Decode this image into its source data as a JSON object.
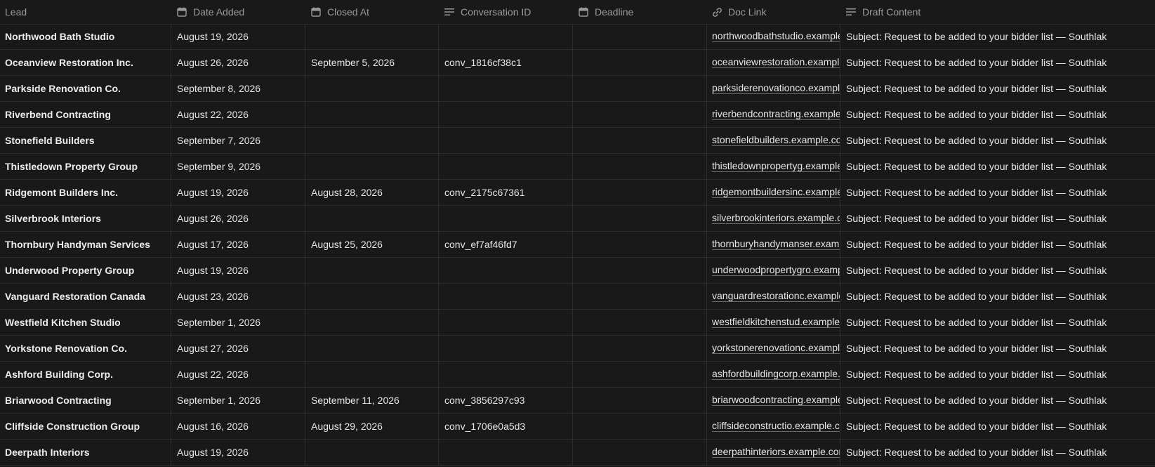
{
  "columns": [
    {
      "key": "lead",
      "label": "Lead",
      "icon": "none"
    },
    {
      "key": "date_added",
      "label": "Date Added",
      "icon": "calendar-icon"
    },
    {
      "key": "closed_at",
      "label": "Closed At",
      "icon": "calendar-icon"
    },
    {
      "key": "conversation_id",
      "label": "Conversation ID",
      "icon": "text-lines-icon"
    },
    {
      "key": "deadline",
      "label": "Deadline",
      "icon": "calendar-icon"
    },
    {
      "key": "doc_link",
      "label": "Doc Link",
      "icon": "link-icon"
    },
    {
      "key": "draft_content",
      "label": "Draft Content",
      "icon": "text-lines-icon"
    }
  ],
  "rows": [
    {
      "lead": "Northwood Bath Studio",
      "date_added": "August 19, 2026",
      "closed_at": "",
      "conversation_id": "",
      "deadline": "",
      "doc_link": "northwoodbathstudio.example",
      "draft_content": "Subject: Request to be added to your bidder list — Southlak"
    },
    {
      "lead": "Oceanview Restoration Inc.",
      "date_added": "August 26, 2026",
      "closed_at": "September 5, 2026",
      "conversation_id": "conv_1816cf38c1",
      "deadline": "",
      "doc_link": "oceanviewrestoration.example",
      "draft_content": "Subject: Request to be added to your bidder list — Southlak"
    },
    {
      "lead": "Parkside Renovation Co.",
      "date_added": "September 8, 2026",
      "closed_at": "",
      "conversation_id": "",
      "deadline": "",
      "doc_link": "parksiderenovationco.example",
      "draft_content": "Subject: Request to be added to your bidder list — Southlak"
    },
    {
      "lead": "Riverbend Contracting",
      "date_added": "August 22, 2026",
      "closed_at": "",
      "conversation_id": "",
      "deadline": "",
      "doc_link": "riverbendcontracting.example",
      "draft_content": "Subject: Request to be added to your bidder list — Southlak"
    },
    {
      "lead": "Stonefield Builders",
      "date_added": "September 7, 2026",
      "closed_at": "",
      "conversation_id": "",
      "deadline": "",
      "doc_link": "stonefieldbuilders.example.co",
      "draft_content": "Subject: Request to be added to your bidder list — Southlak"
    },
    {
      "lead": "Thistledown Property Group",
      "date_added": "September 9, 2026",
      "closed_at": "",
      "conversation_id": "",
      "deadline": "",
      "doc_link": "thistledownpropertyg.example",
      "draft_content": "Subject: Request to be added to your bidder list — Southlak"
    },
    {
      "lead": "Ridgemont Builders Inc.",
      "date_added": "August 19, 2026",
      "closed_at": "August 28, 2026",
      "conversation_id": "conv_2175c67361",
      "deadline": "",
      "doc_link": "ridgemontbuildersinc.example",
      "draft_content": "Subject: Request to be added to your bidder list — Southlak"
    },
    {
      "lead": "Silverbrook Interiors",
      "date_added": "August 26, 2026",
      "closed_at": "",
      "conversation_id": "",
      "deadline": "",
      "doc_link": "silverbrookinteriors.example.c",
      "draft_content": "Subject: Request to be added to your bidder list — Southlak"
    },
    {
      "lead": "Thornbury Handyman Services",
      "date_added": "August 17, 2026",
      "closed_at": "August 25, 2026",
      "conversation_id": "conv_ef7af46fd7",
      "deadline": "",
      "doc_link": "thornburyhandymanser.examp",
      "draft_content": "Subject: Request to be added to your bidder list — Southlak"
    },
    {
      "lead": "Underwood Property Group",
      "date_added": "August 19, 2026",
      "closed_at": "",
      "conversation_id": "",
      "deadline": "",
      "doc_link": "underwoodpropertygro.examp",
      "draft_content": "Subject: Request to be added to your bidder list — Southlak"
    },
    {
      "lead": "Vanguard Restoration Canada",
      "date_added": "August 23, 2026",
      "closed_at": "",
      "conversation_id": "",
      "deadline": "",
      "doc_link": "vanguardrestorationc.example",
      "draft_content": "Subject: Request to be added to your bidder list — Southlak"
    },
    {
      "lead": "Westfield Kitchen Studio",
      "date_added": "September 1, 2026",
      "closed_at": "",
      "conversation_id": "",
      "deadline": "",
      "doc_link": "westfieldkitchenstud.example",
      "draft_content": "Subject: Request to be added to your bidder list — Southlak"
    },
    {
      "lead": "Yorkstone Renovation Co.",
      "date_added": "August 27, 2026",
      "closed_at": "",
      "conversation_id": "",
      "deadline": "",
      "doc_link": "yorkstonerenovationc.example",
      "draft_content": "Subject: Request to be added to your bidder list — Southlak"
    },
    {
      "lead": "Ashford Building Corp.",
      "date_added": "August 22, 2026",
      "closed_at": "",
      "conversation_id": "",
      "deadline": "",
      "doc_link": "ashfordbuildingcorp.example.",
      "draft_content": "Subject: Request to be added to your bidder list — Southlak"
    },
    {
      "lead": "Briarwood Contracting",
      "date_added": "September 1, 2026",
      "closed_at": "September 11, 2026",
      "conversation_id": "conv_3856297c93",
      "deadline": "",
      "doc_link": "briarwoodcontracting.example",
      "draft_content": "Subject: Request to be added to your bidder list — Southlak"
    },
    {
      "lead": "Cliffside Construction Group",
      "date_added": "August 16, 2026",
      "closed_at": "August 29, 2026",
      "conversation_id": "conv_1706e0a5d3",
      "deadline": "",
      "doc_link": "cliffsideconstructio.example.c",
      "draft_content": "Subject: Request to be added to your bidder list — Southlak"
    },
    {
      "lead": "Deerpath Interiors",
      "date_added": "August 19, 2026",
      "closed_at": "",
      "conversation_id": "",
      "deadline": "",
      "doc_link": "deerpathinteriors.example.con",
      "draft_content": "Subject: Request to be added to your bidder list — Southlak"
    }
  ],
  "colors": {
    "background": "#191919",
    "border": "#2d2d2d",
    "header_text": "#9b9b9b",
    "cell_text": "#e6e6e6"
  }
}
